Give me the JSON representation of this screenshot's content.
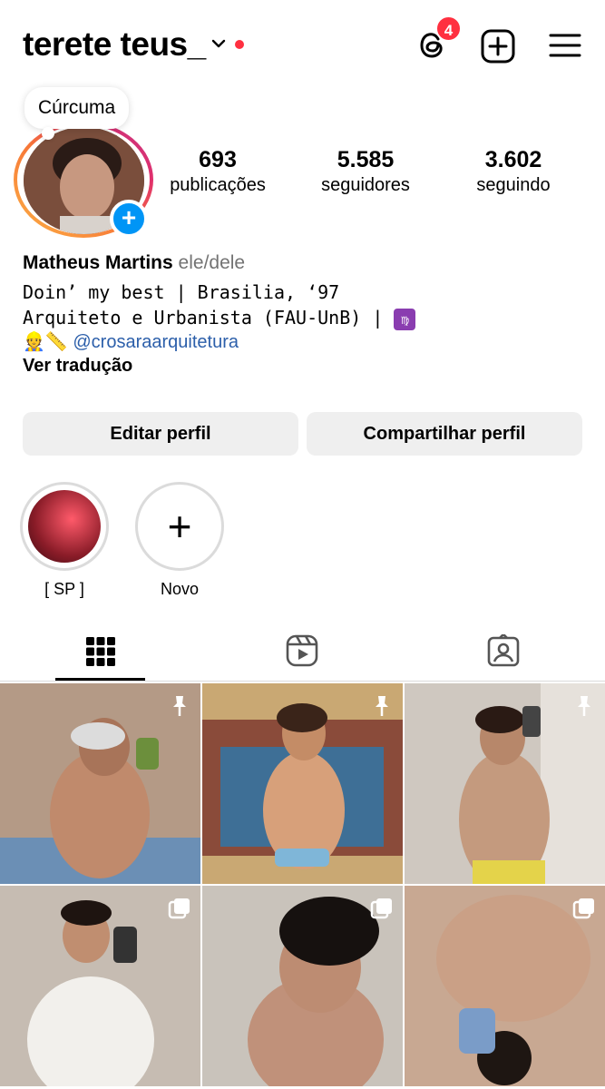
{
  "header": {
    "username": "terete teus_",
    "notification_count": "4"
  },
  "note": {
    "text": "Cúrcuma"
  },
  "stats": [
    {
      "value": "693",
      "label": "publicações"
    },
    {
      "value": "5.585",
      "label": "seguidores"
    },
    {
      "value": "3.602",
      "label": "seguindo"
    }
  ],
  "bio": {
    "name": "Matheus Martins",
    "pronouns": "ele/dele",
    "line1": "Doin’ my best | Brasilia, ‘97",
    "line2": "Arquiteto e Urbanista (FAU-UnB) |",
    "line2_emoji": "♍",
    "line3_emoji": "👷📏",
    "line3_mention": "@crosaraarquitetura",
    "translate": "Ver tradução"
  },
  "actions": {
    "edit": "Editar perfil",
    "share": "Compartilhar perfil"
  },
  "highlights": [
    {
      "label": "[ SP ]"
    },
    {
      "label": "Novo"
    }
  ],
  "tabs": [
    {
      "icon": "grid-icon",
      "active": true
    },
    {
      "icon": "reels-icon",
      "active": false
    },
    {
      "icon": "tagged-icon",
      "active": false
    }
  ],
  "posts": [
    {
      "icon": "pin-icon",
      "tone": "#b49a86"
    },
    {
      "icon": "pin-icon",
      "tone": "#c9a873"
    },
    {
      "icon": "pin-icon",
      "tone": "#cfc8c0"
    },
    {
      "icon": "carousel-icon",
      "tone": "#c6bcb2"
    },
    {
      "icon": "carousel-icon",
      "tone": "#b8b2aa"
    },
    {
      "icon": "carousel-icon",
      "tone": "#c8a892"
    }
  ],
  "colors": {
    "accent": "#0095f6",
    "badge": "#ff3040",
    "link": "#2c5faa"
  }
}
